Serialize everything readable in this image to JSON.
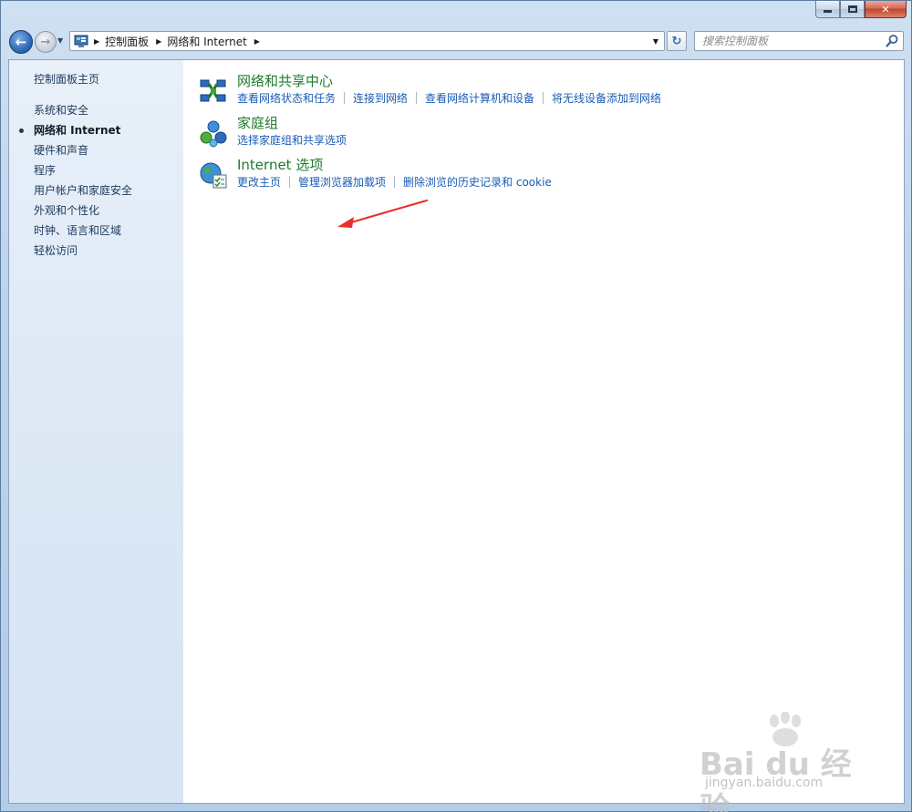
{
  "window": {
    "caption": {
      "minimize": "—",
      "maximize": "□",
      "close": "✕"
    }
  },
  "toolbar": {
    "back_glyph": "←",
    "forward_glyph": "→",
    "breadcrumb": [
      "控制面板",
      "网络和 Internet"
    ],
    "search_placeholder": "搜索控制面板",
    "refresh_glyph": "↻"
  },
  "sidebar": {
    "home": "控制面板主页",
    "items": [
      {
        "label": "系统和安全",
        "active": false
      },
      {
        "label": "网络和 Internet",
        "active": true
      },
      {
        "label": "硬件和声音",
        "active": false
      },
      {
        "label": "程序",
        "active": false
      },
      {
        "label": "用户帐户和家庭安全",
        "active": false
      },
      {
        "label": "外观和个性化",
        "active": false
      },
      {
        "label": "时钟、语言和区域",
        "active": false
      },
      {
        "label": "轻松访问",
        "active": false
      }
    ]
  },
  "categories": [
    {
      "title": "网络和共享中心",
      "icon": "network-sharing-center-icon",
      "links": [
        "查看网络状态和任务",
        "连接到网络",
        "查看网络计算机和设备",
        "将无线设备添加到网络"
      ]
    },
    {
      "title": "家庭组",
      "icon": "homegroup-icon",
      "links": [
        "选择家庭组和共享选项"
      ]
    },
    {
      "title": "Internet 选项",
      "icon": "internet-options-icon",
      "links": [
        "更改主页",
        "管理浏览器加载项",
        "删除浏览的历史记录和 cookie"
      ]
    }
  ],
  "watermark": {
    "brand": "Bai du 经验",
    "url": "jingyan.baidu.com"
  },
  "colors": {
    "category_title": "#1e7a2c",
    "link": "#1a5cb6",
    "annotation_arrow": "#e8302b"
  }
}
